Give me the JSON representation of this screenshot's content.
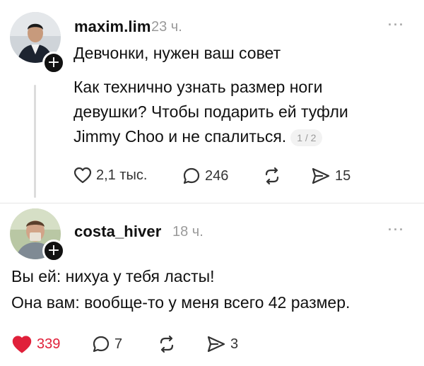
{
  "posts": [
    {
      "username": "maxim.lim",
      "time": "23 ч.",
      "more": "···",
      "plus": "+",
      "paragraph1": "Девчонки, нужен ваш совет",
      "paragraph2_lines": [
        "Как технично узнать размер ноги",
        "девушки? Чтобы подарить ей туфли",
        "Jimmy Choo и не спалиться."
      ],
      "pager": "1 / 2",
      "actions": {
        "likes": "2,1 тыс.",
        "comments": "246",
        "shares": "15"
      },
      "icons": [
        "heart-icon",
        "comment-icon",
        "repost-icon",
        "share-icon"
      ]
    },
    {
      "username": "costa_hiver",
      "time": "18 ч.",
      "more": "···",
      "plus": "+",
      "lines": [
        "Вы ей: нихуа у тебя ласты!",
        "Она вам: вообще-то у меня всего 42 размер."
      ],
      "actions": {
        "likes": "339",
        "comments": "7",
        "shares": "3"
      },
      "liked_color": "#e0203a"
    }
  ]
}
